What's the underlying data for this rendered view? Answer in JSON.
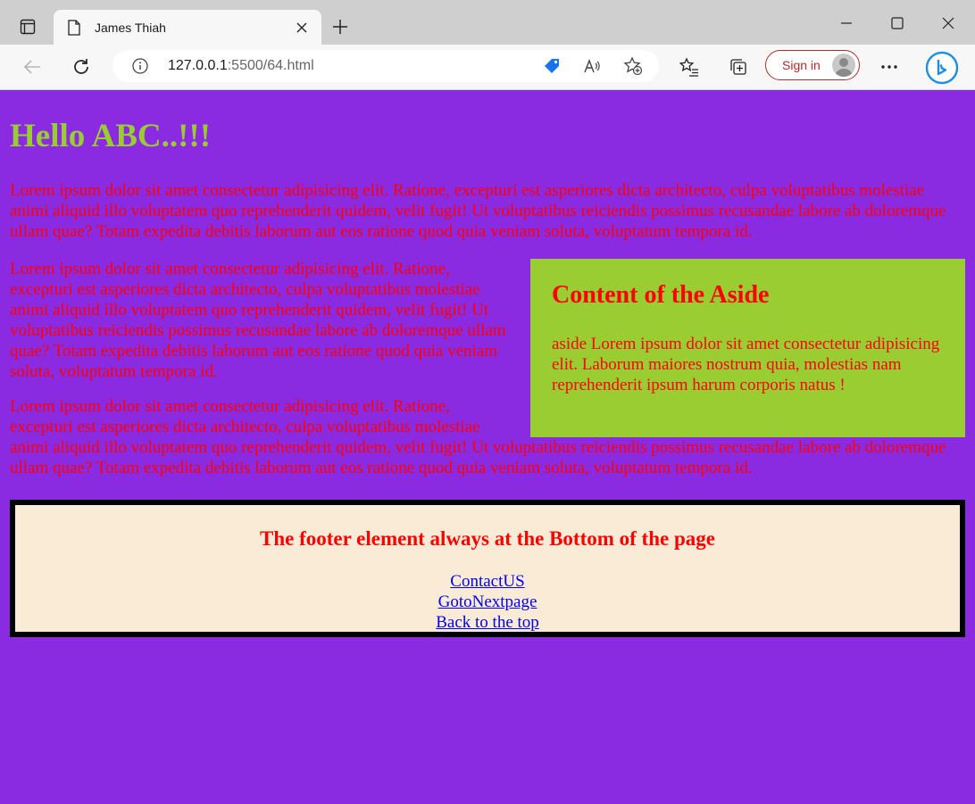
{
  "browser": {
    "tab_title": "James Thiah",
    "url_host": "127.0.0.1",
    "url_path": ":5500/64.html",
    "signin_label": "Sign in"
  },
  "page": {
    "heading": "Hello ABC..!!!",
    "paragraph1": "Lorem ipsum dolor sit amet consectetur adipisicing elit. Ratione, excepturi est asperiores dicta architecto, culpa voluptatibus molestiae animi aliquid illo voluptatem quo reprehenderit quidem, velit fugit! Ut voluptatibus reiciendis possimus recusandae labore ab doloremque ullam quae? Totam expedita debitis laborum aut eos ratione quod quia veniam soluta, voluptatum tempora id.",
    "paragraph2": "Lorem ipsum dolor sit amet consectetur adipisicing elit. Ratione, excepturi est asperiores dicta architecto, culpa voluptatibus molestiae animi aliquid illo voluptatem quo reprehenderit quidem, velit fugit! Ut voluptatibus reiciendis possimus recusandae labore ab doloremque ullam quae? Totam expedita debitis laborum aut eos ratione quod quia veniam soluta, voluptatum tempora id.",
    "paragraph3": "Lorem ipsum dolor sit amet consectetur adipisicing elit. Ratione, excepturi est asperiores dicta architecto, culpa voluptatibus molestiae animi aliquid illo voluptatem quo reprehenderit quidem, velit fugit! Ut voluptatibus reiciendis possimus recusandae labore ab doloremque ullam quae? Totam expedita debitis laborum aut eos ratione quod quia veniam soluta, voluptatum tempora id.",
    "aside": {
      "title": "Content of the Aside",
      "text": "aside Lorem ipsum dolor sit amet consectetur adipisicing elit. Laborum maiores nostrum quia, molestias nam reprehenderit ipsum harum corporis natus !"
    },
    "footer": {
      "title": "The footer element always at the Bottom of the page",
      "links": [
        "ContactUS",
        "GotoNextpage",
        "Back to the top"
      ]
    }
  },
  "colors": {
    "background": "#8a2be2",
    "heading": "#9acd32",
    "text": "#ff0000",
    "aside_bg": "#9acd32",
    "footer_bg": "#faebd7",
    "link": "#0000ee"
  }
}
